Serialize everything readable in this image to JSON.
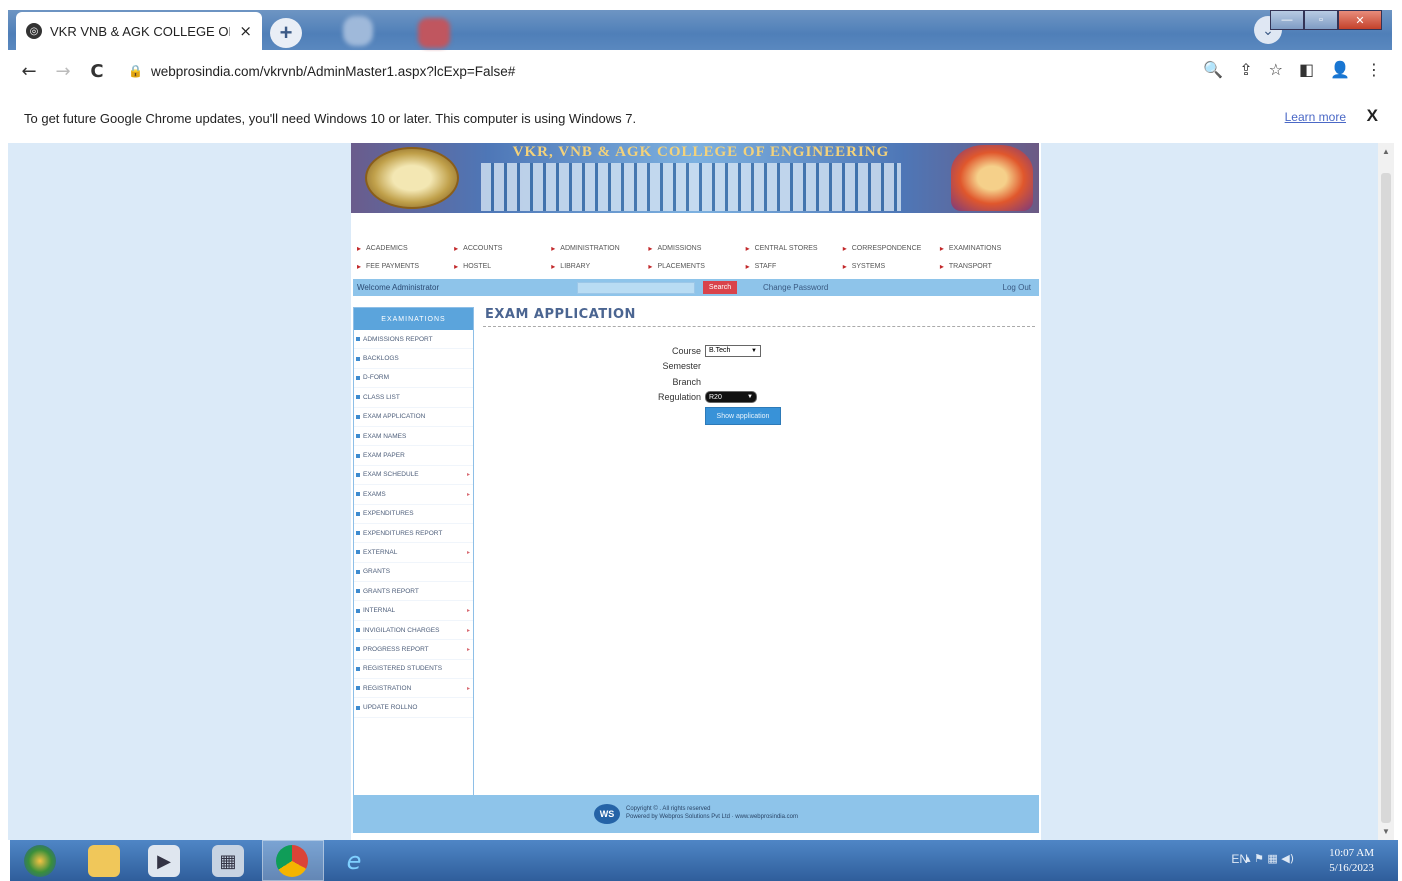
{
  "browser": {
    "tab_title": "VKR VNB & AGK COLLEGE OF E",
    "tab_close": "×",
    "new_tab": "+",
    "url": "webprosindia.com/vkrvnb/AdminMaster1.aspx?lcExp=False#",
    "back": "←",
    "forward": "→",
    "reload": "C",
    "lock": "🔒",
    "right_icons": [
      "🔍",
      "⇪",
      "☆",
      "◧",
      "👤",
      "⋮"
    ],
    "window_buttons": [
      "—",
      "▫",
      "✕"
    ]
  },
  "infobar": {
    "message": "To get future Google Chrome updates, you'll need Windows 10 or later. This computer is using Windows 7.",
    "learn_more": "Learn more",
    "close": "X"
  },
  "site": {
    "college_name": "VKR, VNB & AGK COLLEGE OF ENGINEERING",
    "menu_row1": [
      "ACADEMICS",
      "ACCOUNTS",
      "ADMINISTRATION",
      "ADMISSIONS",
      "CENTRAL STORES",
      "CORRESPONDENCE",
      "EXAMINATIONS"
    ],
    "menu_row2": [
      "FEE PAYMENTS",
      "HOSTEL",
      "LIBRARY",
      "PLACEMENTS",
      "STAFF",
      "SYSTEMS",
      "TRANSPORT"
    ],
    "welcome": "Welcome Administrator",
    "search_label": "Search",
    "change_password": "Change Password",
    "logout": "Log Out",
    "sidebar_title": "EXAMINATIONS",
    "sidebar_items": [
      {
        "label": "ADMISSIONS REPORT",
        "arrow": ""
      },
      {
        "label": "BACKLOGS",
        "arrow": ""
      },
      {
        "label": "D-FORM",
        "arrow": ""
      },
      {
        "label": "CLASS LIST",
        "arrow": ""
      },
      {
        "label": "EXAM APPLICATION",
        "arrow": ""
      },
      {
        "label": "EXAM NAMES",
        "arrow": ""
      },
      {
        "label": "EXAM PAPER",
        "arrow": ""
      },
      {
        "label": "EXAM SCHEDULE",
        "arrow": "▸"
      },
      {
        "label": "EXAMS",
        "arrow": "▸"
      },
      {
        "label": "EXPENDITURES",
        "arrow": ""
      },
      {
        "label": "EXPENDITURES REPORT",
        "arrow": ""
      },
      {
        "label": "EXTERNAL",
        "arrow": "▸"
      },
      {
        "label": "GRANTS",
        "arrow": ""
      },
      {
        "label": "GRANTS REPORT",
        "arrow": ""
      },
      {
        "label": "INTERNAL",
        "arrow": "▸"
      },
      {
        "label": "INVIGILATION CHARGES",
        "arrow": "▸"
      },
      {
        "label": "PROGRESS REPORT",
        "arrow": "▸"
      },
      {
        "label": "REGISTERED STUDENTS",
        "arrow": ""
      },
      {
        "label": "REGISTRATION",
        "arrow": "▸"
      },
      {
        "label": "UPDATE ROLLNO",
        "arrow": ""
      }
    ],
    "page_title": "EXAM APPLICATION",
    "form": {
      "course_label": "Course",
      "course_value": "B.Tech",
      "semester_label": "Semester",
      "branch_label": "Branch",
      "regulation_label": "Regulation",
      "regulation_value": "R20",
      "submit": "Show application"
    },
    "footer_logo": "WS",
    "footer_line1": "Copyright © . All rights reserved",
    "footer_line2": "Powered by Webpros Solutions Pvt Ltd · www.webprosindia.com"
  },
  "taskbar": {
    "tray_lang": "EN",
    "tray_icons": "▴  ⚑  ▦  ◀)",
    "time": "10:07 AM",
    "date": "5/16/2023"
  },
  "colors": {
    "page_bg": "#dbeaf8",
    "accent": "#5ba4dc",
    "search_button": "#d9434b"
  }
}
